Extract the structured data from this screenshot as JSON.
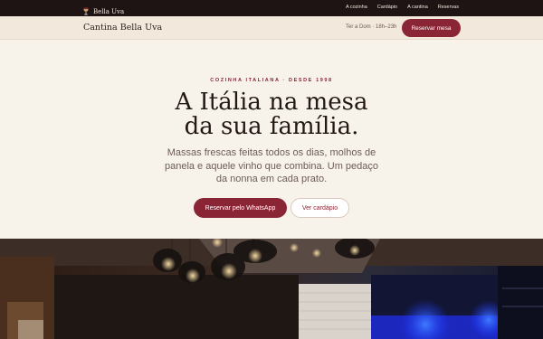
{
  "topbar": {
    "brand": "Bella Uva",
    "links": [
      "A cozinha",
      "Cardápio",
      "A cantina",
      "Reservas"
    ]
  },
  "header": {
    "title": "Cantina Bella Uva",
    "hours": "Ter a Dom · 18h–23h",
    "reserve_label": "Reservar mesa"
  },
  "hero": {
    "eyebrow": "COZINHA ITALIANA · DESDE 1998",
    "headline_line1": "A Itália na mesa",
    "headline_line2": "da sua família.",
    "subtitle": "Massas frescas feitas todos os dias, molhos de panela e aquele vinho que combina. Um pedaço da nonna em cada prato.",
    "cta_primary": "Reservar pelo WhatsApp",
    "cta_secondary": "Ver cardápio"
  },
  "colors": {
    "accent": "#8a2535",
    "topbar_bg": "#1d1413",
    "header_bg": "#f2e8dc",
    "page_bg": "#f8f3ea"
  },
  "icons": {
    "brand": "wine-glass-icon"
  }
}
